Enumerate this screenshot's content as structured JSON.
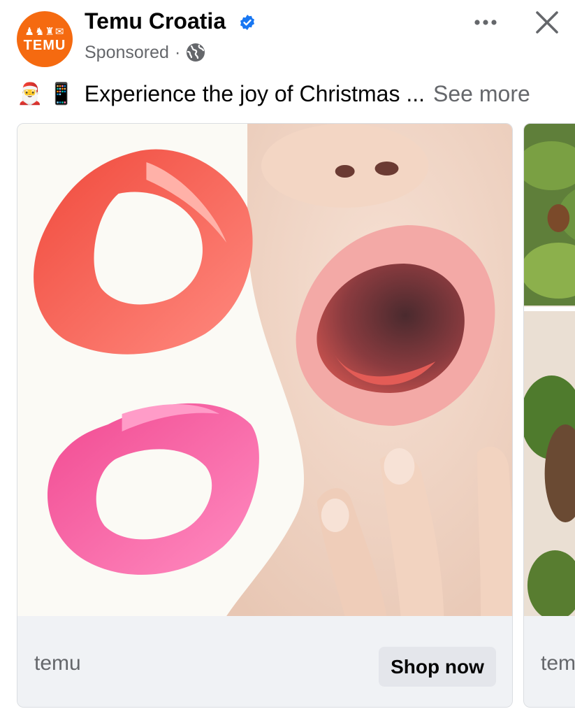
{
  "post": {
    "page_name": "Temu Croatia",
    "verified": true,
    "sponsored_label": "Sponsored",
    "separator": "·",
    "audience_icon": "globe-icon",
    "avatar": {
      "logo_text": "TEMU",
      "glyphs": "♟♞♜✉",
      "color": "#f56a10"
    }
  },
  "caption": {
    "emoji_1": "🎅",
    "emoji_2": "📱",
    "text": "Experience the joy of Christmas ...",
    "see_more": "See more"
  },
  "carousel": {
    "cards": [
      {
        "domain": "temu",
        "cta": "Shop now"
      },
      {
        "domain": "temu"
      }
    ]
  },
  "icons": {
    "more": "more-options-icon",
    "close": "close-icon",
    "verified": "verified-badge-icon"
  },
  "colors": {
    "accent_blue": "#1877f2",
    "text_primary": "#050505",
    "text_secondary": "#65676b",
    "card_footer_bg": "#f0f2f5",
    "cta_bg": "#e4e6eb",
    "brand_orange": "#f56a10"
  }
}
